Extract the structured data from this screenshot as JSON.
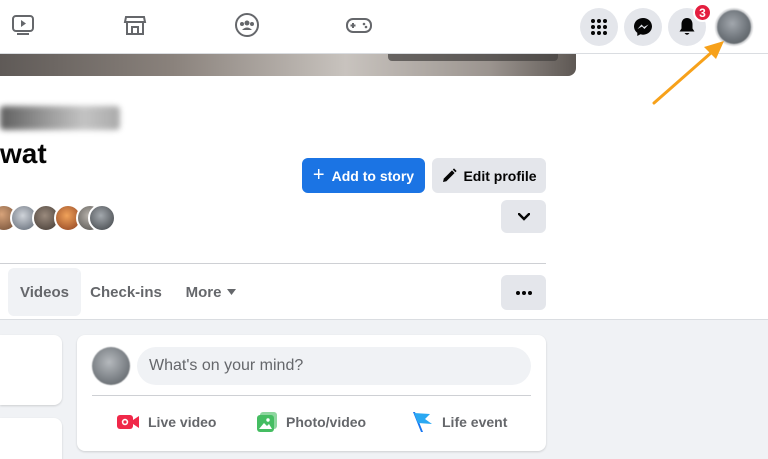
{
  "nav": {
    "icons": [
      "watch-icon",
      "marketplace-icon",
      "groups-icon",
      "gaming-icon"
    ],
    "menu_icon": "grid-menu-icon",
    "messenger_icon": "messenger-icon",
    "notifications_icon": "bell-icon",
    "notification_count": "3"
  },
  "profile": {
    "name_line2": "wat",
    "add_story_label": "Add to story",
    "edit_profile_label": "Edit profile"
  },
  "tabs": [
    "Videos",
    "Check-ins",
    "More"
  ],
  "composer": {
    "placeholder": "What's on your mind?",
    "actions": [
      {
        "label": "Live video",
        "icon": "live-video-icon",
        "color": "#f02849"
      },
      {
        "label": "Photo/video",
        "icon": "photo-video-icon",
        "color": "#45bd62"
      },
      {
        "label": "Life event",
        "icon": "life-event-icon",
        "color": "#1877f2"
      }
    ]
  },
  "colors": {
    "primary": "#1b74e4",
    "badge": "#e41e3f",
    "annotation_arrow": "#f7a11a"
  }
}
